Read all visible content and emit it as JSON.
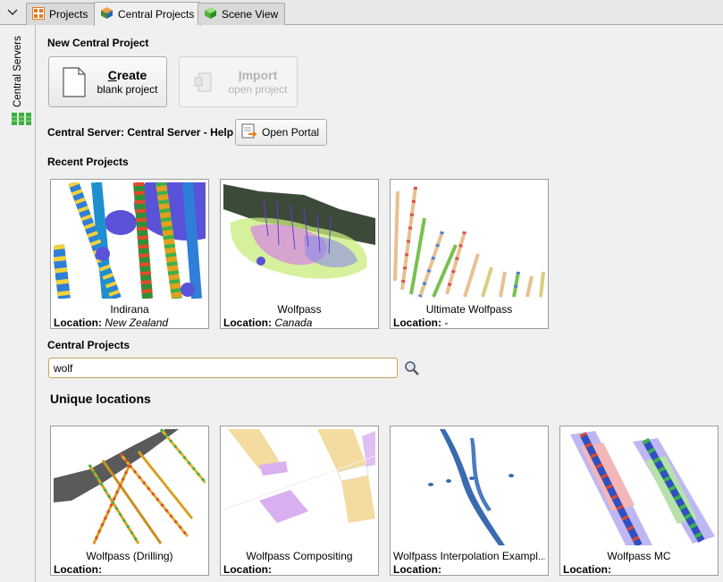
{
  "tabs": [
    {
      "label": "Projects",
      "icon": "projects-grid-icon"
    },
    {
      "label": "Central Projects",
      "icon": "central-cube-icon",
      "active": true
    },
    {
      "label": "Scene View",
      "icon": "scene-cube-icon"
    }
  ],
  "sidebar": {
    "label": "Central Servers"
  },
  "new_project": {
    "title": "New Central Project",
    "create": {
      "main": "Create",
      "sub": "blank project"
    },
    "import": {
      "main": "Import",
      "sub": "open project",
      "disabled": true
    }
  },
  "server": {
    "label": "Central Server: Central Server - Help",
    "portal_button": "Open Portal"
  },
  "recent": {
    "title": "Recent Projects",
    "location_label": "Location:",
    "items": [
      {
        "name": "Indirana",
        "location": "New Zealand"
      },
      {
        "name": "Wolfpass",
        "location": "Canada"
      },
      {
        "name": "Ultimate Wolfpass",
        "location": "-"
      }
    ]
  },
  "central": {
    "title": "Central Projects",
    "search_value": "wolf",
    "unique_title": "Unique locations",
    "items": [
      {
        "name": "Wolfpass (Drilling)",
        "location": ""
      },
      {
        "name": "Wolfpass Compositing",
        "location": ""
      },
      {
        "name": "Wolfpass Interpolation Exampl...",
        "location": ""
      },
      {
        "name": "Wolfpass MC",
        "location": ""
      }
    ]
  },
  "colors": {
    "accent_orange": "#e8801e",
    "search_border": "#c9a35a",
    "green_icon": "#3fae3f"
  }
}
